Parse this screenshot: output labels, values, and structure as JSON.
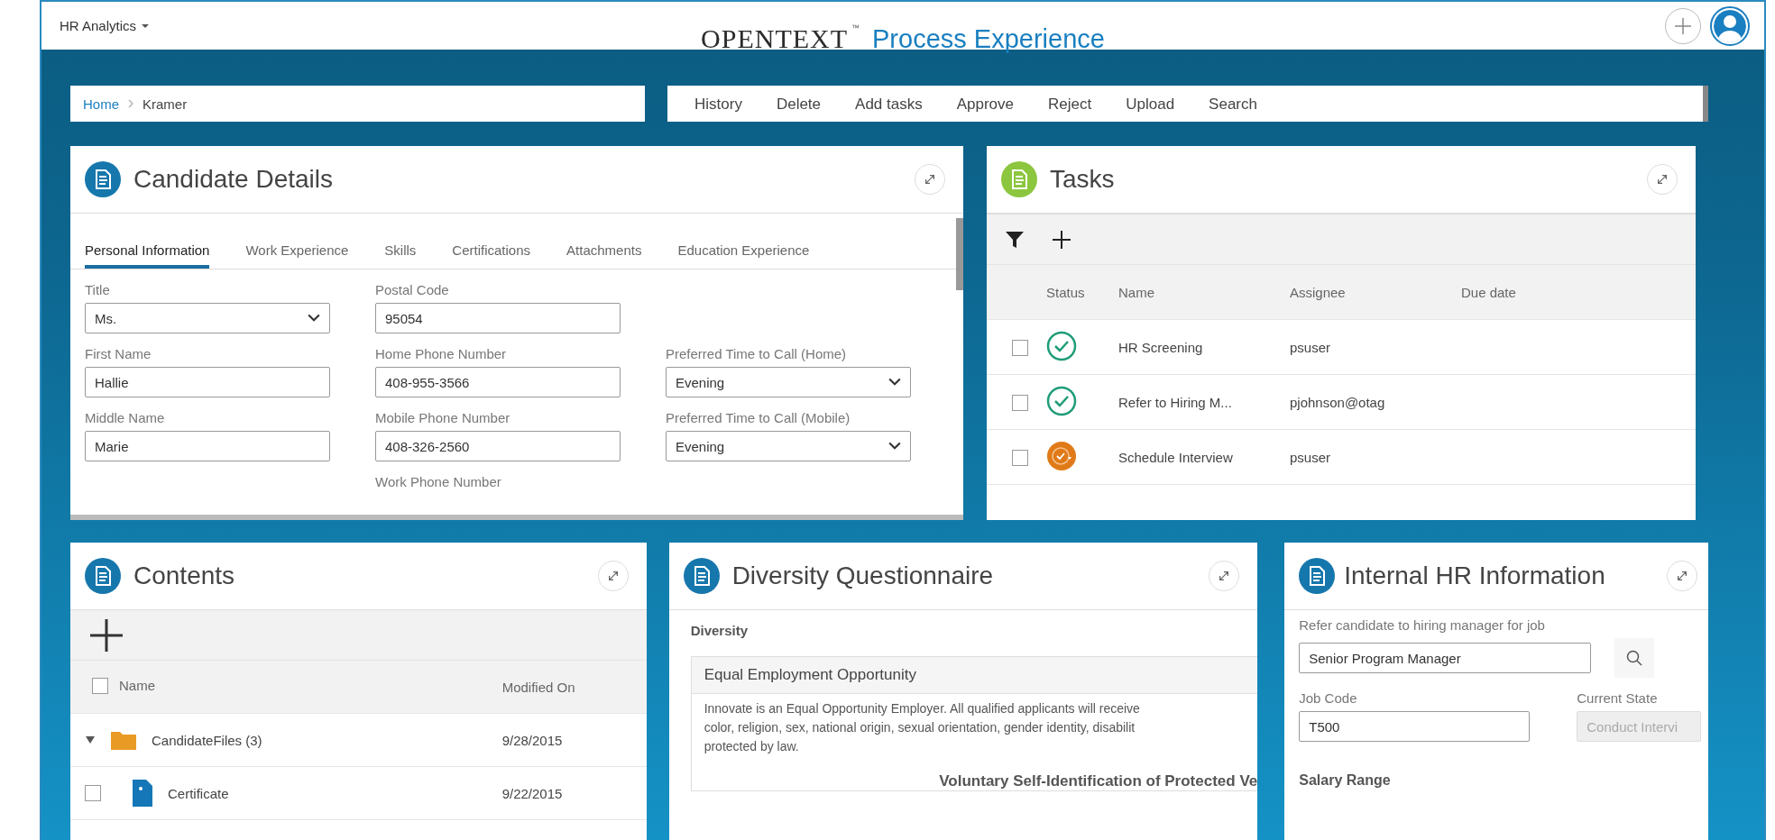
{
  "header": {
    "workspace": "HR Analytics",
    "brand": "OPENTEXT",
    "brand_mark": "™",
    "product": "Process Experience"
  },
  "breadcrumb": [
    "Home",
    "Kramer"
  ],
  "actions": [
    "History",
    "Delete",
    "Add tasks",
    "Approve",
    "Reject",
    "Upload",
    "Search"
  ],
  "candidate": {
    "title": "Candidate Details",
    "tabs": [
      {
        "label": "Personal Information",
        "selected": true
      },
      {
        "label": "Work Experience",
        "selected": false
      },
      {
        "label": "Skills",
        "selected": false
      },
      {
        "label": "Certifications",
        "selected": false
      },
      {
        "label": "Attachments",
        "selected": false
      },
      {
        "label": "Education Experience",
        "selected": false
      }
    ],
    "columns": [
      [
        {
          "kind": "select",
          "label": "Title",
          "value": "Ms."
        },
        {
          "kind": "text",
          "label": "First Name",
          "value": "Hallie"
        },
        {
          "kind": "text",
          "label": "Middle Name",
          "value": "Marie"
        }
      ],
      [
        {
          "kind": "text",
          "label": "Postal Code",
          "value": "95054"
        },
        {
          "kind": "text",
          "label": "Home Phone Number",
          "value": "408-955-3566"
        },
        {
          "kind": "text",
          "label": "Mobile Phone Number",
          "value": "408-326-2560"
        },
        {
          "kind": "label",
          "label": "Work Phone Number"
        }
      ],
      [
        {
          "kind": "select",
          "label": "Preferred Time to Call (Home)",
          "value": "Evening"
        },
        {
          "kind": "select",
          "label": "Preferred Time to Call (Mobile)",
          "value": "Evening"
        }
      ]
    ]
  },
  "tasks": {
    "title": "Tasks",
    "columns": [
      "Status",
      "Name",
      "Assignee",
      "Due date"
    ],
    "rows": [
      {
        "checked": false,
        "kind": "completed",
        "name": "HR Screening",
        "assignee": "psuser"
      },
      {
        "checked": false,
        "kind": "completed",
        "name": "Refer to Hiring M...",
        "assignee": "pjohnson@otag"
      },
      {
        "checked": false,
        "kind": "pending",
        "name": "Schedule Interview",
        "assignee": "psuser"
      }
    ]
  },
  "contents": {
    "title": "Contents",
    "columns": [
      "Name",
      "Modified On"
    ],
    "all_checked": false,
    "items": [
      {
        "kind": "folder",
        "name": "CandidateFiles (3)",
        "modified": "9/28/2015",
        "expanded": true,
        "children": [
          {
            "kind": "file",
            "name": "Certificate",
            "modified": "9/22/2015",
            "checked": false
          }
        ]
      }
    ]
  },
  "diversity": {
    "title": "Diversity Questionnaire",
    "section": "Diversity",
    "box_title": "Equal Employment Opportunity",
    "lines": [
      "Innovate is an Equal Opportunity Employer. All qualified applicants will receive",
      "color, religion, sex, national origin, sexual orientation, gender identity, disabilit",
      "protected by law."
    ],
    "subheading": "Voluntary Self-Identification of Protected Ve"
  },
  "internal": {
    "title": "Internal HR Information",
    "job_label": "Refer candidate to hiring manager for job",
    "job_value": "Senior Program Manager",
    "code_label": "Job Code",
    "code_value": "T500",
    "state_label": "Current State",
    "state_value": "Conduct Intervi",
    "state_disabled": true,
    "salary": "Salary Range"
  }
}
